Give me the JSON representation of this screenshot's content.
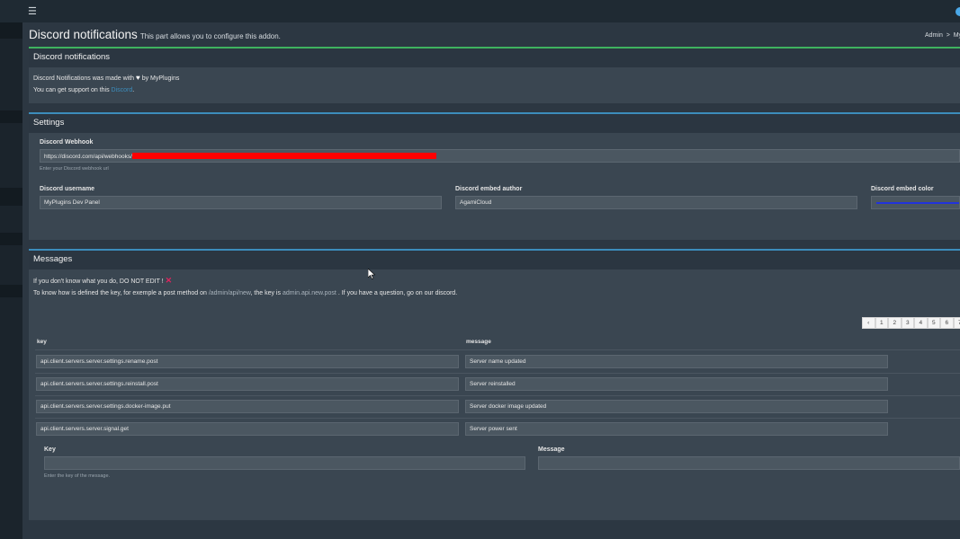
{
  "topbar": {
    "menu_icon": "hamburger-menu-icon"
  },
  "header": {
    "title": "Discord notifications",
    "subtitle": "This part allows you to configure this addon.",
    "breadcrumb_admin": "Admin",
    "breadcrumb_sep": ">",
    "breadcrumb_current": "My"
  },
  "info_box": {
    "title": "Discord notifications",
    "made_prefix": "Discord Notifications was made with",
    "made_suffix": "by MyPlugins",
    "support_prefix": "You can get support on this",
    "support_link": "Discord",
    "support_suffix": "."
  },
  "settings": {
    "title": "Settings",
    "webhook_label": "Discord Webhook",
    "webhook_value": "https://discord.com/api/webhooks/",
    "webhook_hint": "Enter your Discord webhook url",
    "username_label": "Discord username",
    "username_value": "MyPlugins Dev Panel",
    "author_label": "Discord embed author",
    "author_value": "AgamiCloud",
    "color_label": "Discord embed color",
    "embed_color": "#2233dd"
  },
  "messages": {
    "title": "Messages",
    "warning": "If you don't know what you do, DO NOT EDIT !",
    "info_prefix": "To know how is defined the key, for exemple a post method on",
    "info_path": "/admin/api/new",
    "info_mid": ", the key is",
    "info_key": "admin.api.new.post",
    "info_suffix": ". If you have a question, go on our discord.",
    "pager": [
      "‹",
      "1",
      "2",
      "3",
      "4",
      "5",
      "6",
      "7"
    ],
    "col_key": "key",
    "col_message": "message",
    "rows": [
      {
        "key": "api.client.servers.server.settings.rename.post",
        "message": "Server name updated"
      },
      {
        "key": "api.client.servers.server.settings.reinstall.post",
        "message": "Server reinstalled"
      },
      {
        "key": "api.client.servers.server.settings.docker-image.put",
        "message": "Server docker image updated"
      },
      {
        "key": "api.client.servers.server.signal.get",
        "message": "Server power sent"
      }
    ],
    "new_key_label": "Key",
    "new_message_label": "Message",
    "new_key_hint": "Enter the key of the message."
  },
  "colors": {
    "accent_green": "#3fb35f",
    "accent_blue": "#3c8dbc",
    "redaction": "#ff0000"
  }
}
